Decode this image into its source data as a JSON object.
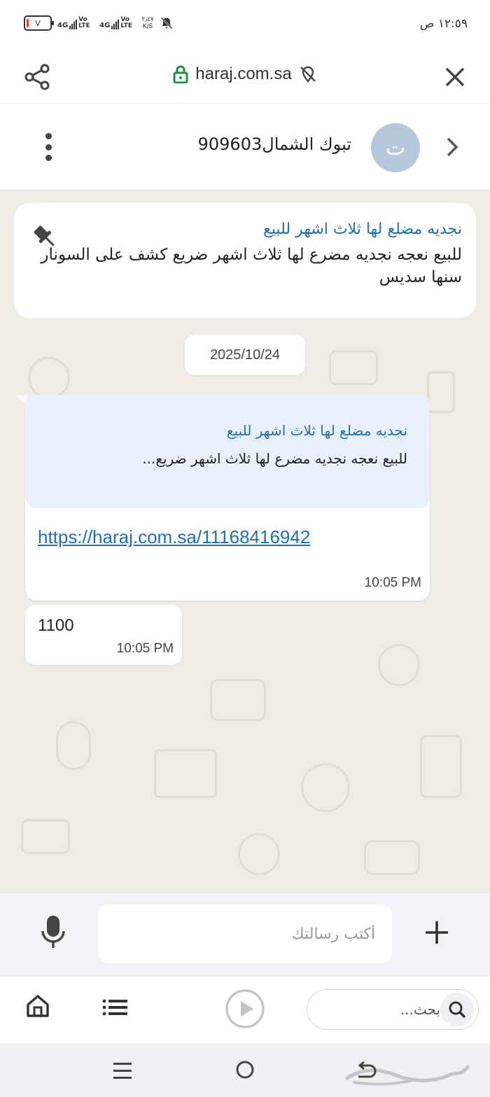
{
  "status_bar": {
    "time": "١٢:٥٩ ص",
    "battery": "V",
    "net1_label": "4G",
    "net1_sub": "Vo LTE",
    "net2_label": "4G",
    "net2_sub": "Vo LTE",
    "speed_value": "٢٫٤٧",
    "speed_unit": "K/S"
  },
  "browser": {
    "url": "haraj.com.sa"
  },
  "chat": {
    "title": "تبوك الشمال909603",
    "avatar_letter": "ت"
  },
  "pinned": {
    "title": "نجديه مضلع لها ثلاث اشهر للبيع",
    "text": "للبيع نعجه نجديه مضرع لها ثلاث اشهر ضريع كشف على السونار سنها سديس"
  },
  "date_chip": "2025/10/24",
  "messages": [
    {
      "preview_title": "نجديه مضلع لها ثلاث اشهر للبيع",
      "preview_text": "للبيع نعجه نجديه مضرع لها ثلاث اشهر ضريع...",
      "link": "https://haraj.com.sa/11168416942",
      "time": "10:05 PM"
    },
    {
      "text": "1100",
      "time": "10:05 PM"
    }
  ],
  "composer": {
    "placeholder": "أكتب رسالتك"
  },
  "toolbar": {
    "search_placeholder": "بحث..."
  },
  "colors": {
    "accent": "#1f6fae",
    "chat_bg": "#efece5",
    "preview_bg": "#e8f1fb",
    "avatar_bg": "#b4c7dd",
    "lock_green": "#1e8e3e"
  }
}
